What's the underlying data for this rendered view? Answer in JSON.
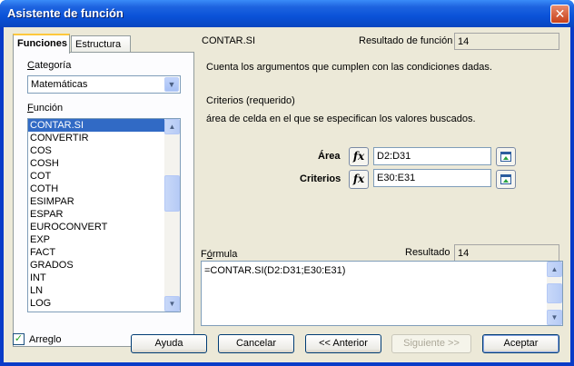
{
  "window": {
    "title": "Asistente de función",
    "close_glyph": "✕"
  },
  "tabs": [
    {
      "label": "Funciones",
      "active": true
    },
    {
      "label": "Estructura",
      "active": false
    }
  ],
  "category": {
    "label_pre": "",
    "label_u": "C",
    "label_post": "ategoría",
    "value": "Matemáticas"
  },
  "function_list": {
    "label_pre": "",
    "label_u": "F",
    "label_post": "unción",
    "items": [
      "CONTAR.SI",
      "CONVERTIR",
      "COS",
      "COSH",
      "COT",
      "COTH",
      "ESIMPAR",
      "ESPAR",
      "EUROCONVERT",
      "EXP",
      "FACT",
      "GRADOS",
      "INT",
      "LN",
      "LOG"
    ],
    "selected": "CONTAR.SI"
  },
  "function_panel": {
    "name": "CONTAR.SI",
    "result_label": "Resultado de función",
    "result_value": "14",
    "description": "Cuenta los argumentos que cumplen con las condiciones dadas.",
    "arg_heading": "Criterios (requerido)",
    "arg_description": "área de celda en el que se especifican los valores buscados."
  },
  "arguments": [
    {
      "label": "Área",
      "value": "D2:D31"
    },
    {
      "label": "Criterios",
      "value": "E30:E31"
    }
  ],
  "fx_label": "fx",
  "formula": {
    "label_pre": "F",
    "label_u": "ó",
    "label_post": "rmula",
    "result_label": "Resultado",
    "result_value": "14",
    "text": "=CONTAR.SI(D2:D31;E30:E31)"
  },
  "checkbox": {
    "label_pre": "Arre",
    "label_u": "g",
    "label_post": "lo",
    "checked": true,
    "mark": "✓"
  },
  "buttons": {
    "help": "Ayuda",
    "cancel": "Cancelar",
    "back": "<< Anterior",
    "next": "Siguiente >>",
    "ok": "Aceptar"
  },
  "icons": {
    "close": "close-icon",
    "dropdown": "chevron-down-icon",
    "fx": "function-icon",
    "shrink": "shrink-icon"
  }
}
